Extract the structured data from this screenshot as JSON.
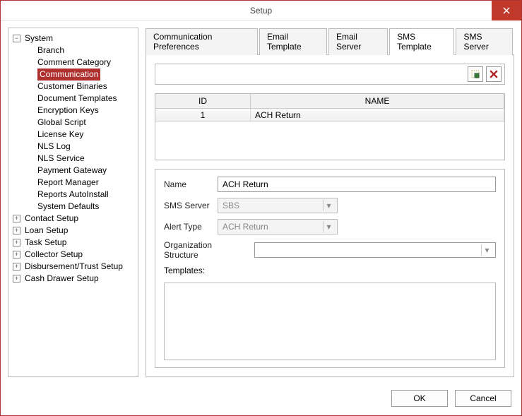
{
  "window": {
    "title": "Setup"
  },
  "tree": {
    "root_expander": "−",
    "collapsed_expander": "+",
    "root": "System",
    "system_children": [
      "Branch",
      "Comment Category",
      "Communication",
      "Customer Binaries",
      "Document Templates",
      "Encryption Keys",
      "Global Script",
      "License Key",
      "NLS Log",
      "NLS Service",
      "Payment Gateway",
      "Report Manager",
      "Reports AutoInstall",
      "System Defaults"
    ],
    "selected_index": 2,
    "other_roots": [
      "Contact Setup",
      "Loan Setup",
      "Task Setup",
      "Collector Setup",
      "Disbursement/Trust Setup",
      "Cash Drawer Setup"
    ]
  },
  "tabs": {
    "items": [
      "Communication Preferences",
      "Email Template",
      "Email Server",
      "SMS Template",
      "SMS Server"
    ],
    "active_index": 3
  },
  "grid": {
    "headers": {
      "id": "ID",
      "name": "NAME"
    },
    "rows": [
      {
        "id": "1",
        "name": "ACH Return"
      }
    ]
  },
  "form": {
    "name_label": "Name",
    "name_value": "ACH Return",
    "sms_server_label": "SMS Server",
    "sms_server_value": "SBS",
    "alert_type_label": "Alert Type",
    "alert_type_value": "ACH Return",
    "org_label": "Organization Structure",
    "org_value": "",
    "templates_label": "Templates:"
  },
  "buttons": {
    "ok": "OK",
    "cancel": "Cancel"
  }
}
